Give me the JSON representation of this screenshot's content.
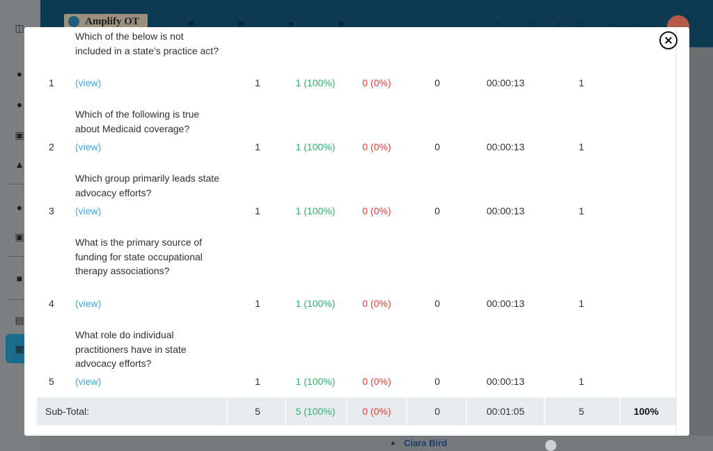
{
  "app": {
    "logo_text": "Amplify OT",
    "user_name": "Clarice Santo"
  },
  "background": {
    "bottom_user": "Ciara Bird"
  },
  "modal": {
    "questions": [
      {
        "number": "1",
        "text": "Which of the below is not included in a state’s practice act?",
        "view_label": "(view)",
        "attempts": "1",
        "correct": "1 (100%)",
        "incorrect": "0 (0%)",
        "skipped": "0",
        "time": "00:00:13",
        "points": "1"
      },
      {
        "number": "2",
        "text": "Which of the following is true about Medicaid coverage?",
        "view_label": "(view)",
        "attempts": "1",
        "correct": "1 (100%)",
        "incorrect": "0 (0%)",
        "skipped": "0",
        "time": "00:00:13",
        "points": "1"
      },
      {
        "number": "3",
        "text": "Which group primarily leads state advocacy efforts?",
        "view_label": "(view)",
        "attempts": "1",
        "correct": "1 (100%)",
        "incorrect": "0 (0%)",
        "skipped": "0",
        "time": "00:00:13",
        "points": "1"
      },
      {
        "number": "4",
        "text": "What is the primary source of funding for state occupational therapy associations?",
        "view_label": "(view)",
        "attempts": "1",
        "correct": "1 (100%)",
        "incorrect": "0 (0%)",
        "skipped": "0",
        "time": "00:00:13",
        "points": "1"
      },
      {
        "number": "5",
        "text": "What role do individual practitioners have in state advocacy efforts?",
        "view_label": "(view)",
        "attempts": "1",
        "correct": "1 (100%)",
        "incorrect": "0 (0%)",
        "skipped": "0",
        "time": "00:00:13",
        "points": "1"
      }
    ],
    "subtotal": {
      "label": "Sub-Total:",
      "attempts": "5",
      "correct": "5 (100%)",
      "incorrect": "0 (0%)",
      "skipped": "0",
      "time": "00:01:05",
      "points": "5",
      "percent": "100%"
    }
  },
  "colors": {
    "header": "#0b3a52",
    "correct": "#27b36a",
    "incorrect": "#e53935",
    "link": "#3aa8df"
  }
}
